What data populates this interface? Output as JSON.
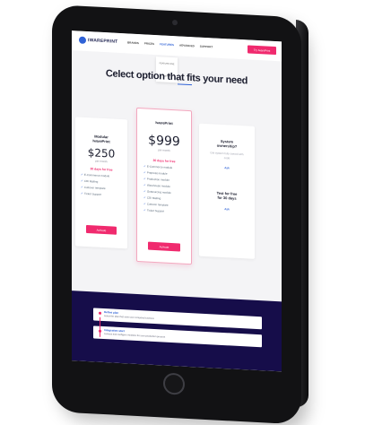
{
  "nav": {
    "logo": "IWAREPRINT",
    "links": [
      "BRANDS",
      "PRICES",
      "FEATURES",
      "ADVANCED",
      "SUPPORT"
    ],
    "active_link": "FEATURES",
    "cta": "Try IwarePrint"
  },
  "dropdown": [
    "FEATURE ONE",
    "SETUP"
  ],
  "heading": "Celect option that fits your need",
  "plans": {
    "left": {
      "title_line1": "Modular",
      "title_line2": "IwarePrint",
      "price": "$250",
      "per": "per month",
      "trial": "30 days for free",
      "features": [
        "E-Commerce module",
        "CDI Mailing",
        "Cuttover template",
        "Ticket Support"
      ],
      "button": "Activate"
    },
    "middle": {
      "title": "IwarePrint",
      "price": "$999",
      "per": "per month",
      "trial": "30 days for free",
      "features": [
        "E-Commerce module",
        "Prepress module",
        "Production module",
        "Warehouse module",
        "Outsourcing module",
        "CDI Mailing",
        "Cuttover template",
        "Ticket Support"
      ],
      "button": "Activate"
    },
    "right": {
      "title_line1": "System",
      "title_line2": "ownership?",
      "sub": "Get system fully owned with code",
      "link1": "Ask",
      "title2_line1": "Test for free",
      "title2_line2": "for 30 days",
      "link2": "Ask"
    }
  },
  "steps": [
    {
      "title": "Define plan",
      "desc": "select the plan that suits your company business"
    },
    {
      "title": "Integration start",
      "desc": "connect and configure modules for your production process"
    }
  ],
  "colors": {
    "accent_pink": "#f02a6e",
    "accent_blue": "#2f62d6",
    "dark_bg": "#160d4a"
  }
}
